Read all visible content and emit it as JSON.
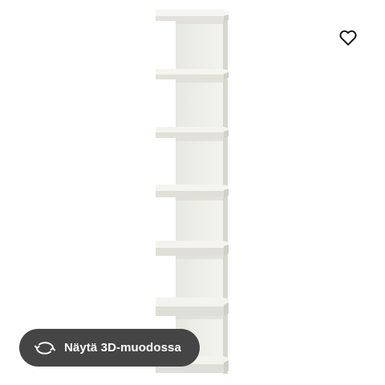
{
  "product": {
    "image_subject": "wall-shelf-unit-icon"
  },
  "favorite": {
    "icon": "heart-outline-icon"
  },
  "view3d": {
    "icon": "rotate-arrows-icon",
    "label": "Näytä 3D-muodossa",
    "background_color": "#454545",
    "text_color": "#ffffff"
  }
}
